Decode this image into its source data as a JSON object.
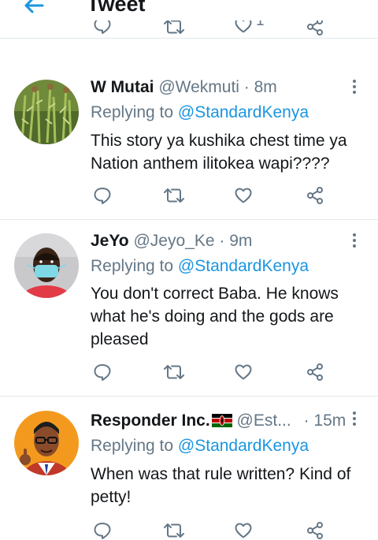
{
  "header": {
    "title": "Tweet",
    "back_icon": "arrow-left-icon"
  },
  "colors": {
    "accent": "#1b95e0",
    "muted": "#657786",
    "text": "#14171a",
    "divider": "#e1e8ed"
  },
  "previous_tweet_actions": {
    "like_count": "1"
  },
  "tweets": [
    {
      "name": "W Mutai",
      "handle": "@Wekmuti",
      "time": "· 8m",
      "replying_prefix": "Replying to ",
      "replying_to": "@StandardKenya",
      "text": "This story ya kushika chest time ya Nation anthem ilitokea wapi????",
      "avatar": "green-plants-photo"
    },
    {
      "name": "JeYo",
      "handle": "@Jeyo_Ke",
      "time": "· 9m",
      "replying_prefix": "Replying to ",
      "replying_to": "@StandardKenya",
      "text": "You don't correct Baba. He knows what he's doing and the gods are pleased",
      "avatar": "person-with-mask-photo"
    },
    {
      "name": "Responder Inc.",
      "handle": "@Est...",
      "time": "· 15m",
      "replying_prefix": "Replying to ",
      "replying_to": "@StandardKenya",
      "text": "When was that rule written? Kind of petty!",
      "avatar": "cartoon-man-thumbs-up",
      "flag": "kenya-flag-icon"
    }
  ]
}
